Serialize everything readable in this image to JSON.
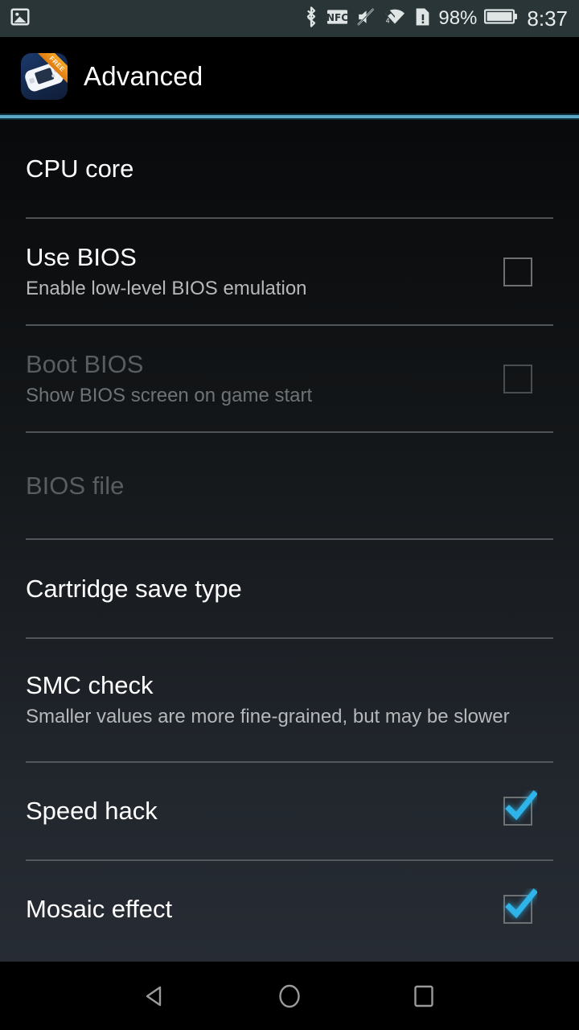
{
  "status_bar": {
    "background_color": "#2a3537",
    "notification_icons": [
      "screenshot-image-icon"
    ],
    "system_icons": [
      "bluetooth-icon",
      "nfc-icon",
      "silent-mute-icon",
      "wifi-icon",
      "sim-card-alert-icon"
    ],
    "battery_percent": "98%",
    "clock": "8:37"
  },
  "action_bar": {
    "app_icon_name": "app-icon-gba-emulator",
    "icon_ribbon_label": "FREE",
    "title": "Advanced",
    "accent_color": "#5aa7c8"
  },
  "settings": {
    "items": [
      {
        "type": "section-header",
        "name": "cpu-core",
        "title": "CPU core",
        "enabled": true
      },
      {
        "type": "checkbox",
        "name": "use-bios",
        "title": "Use BIOS",
        "summary": "Enable low-level BIOS emulation",
        "checked": false,
        "enabled": true
      },
      {
        "type": "checkbox",
        "name": "boot-bios",
        "title": "Boot BIOS",
        "summary": "Show BIOS screen on game start",
        "checked": false,
        "enabled": false
      },
      {
        "type": "preference",
        "name": "bios-file",
        "title": "BIOS file",
        "summary": "",
        "enabled": false
      },
      {
        "type": "section-header",
        "name": "cartridge-save-type",
        "title": "Cartridge save type",
        "enabled": true
      },
      {
        "type": "preference",
        "name": "smc-check",
        "title": "SMC check",
        "summary": "Smaller values are more fine-grained, but may be slower",
        "enabled": true
      },
      {
        "type": "checkbox",
        "name": "speed-hack",
        "title": "Speed hack",
        "summary": "",
        "checked": true,
        "enabled": true
      },
      {
        "type": "checkbox",
        "name": "mosaic-effect",
        "title": "Mosaic effect",
        "summary": "",
        "checked": true,
        "enabled": true
      }
    ]
  },
  "nav_bar": {
    "back_label": "back-icon",
    "home_label": "home-icon",
    "recents_label": "recents-icon"
  }
}
